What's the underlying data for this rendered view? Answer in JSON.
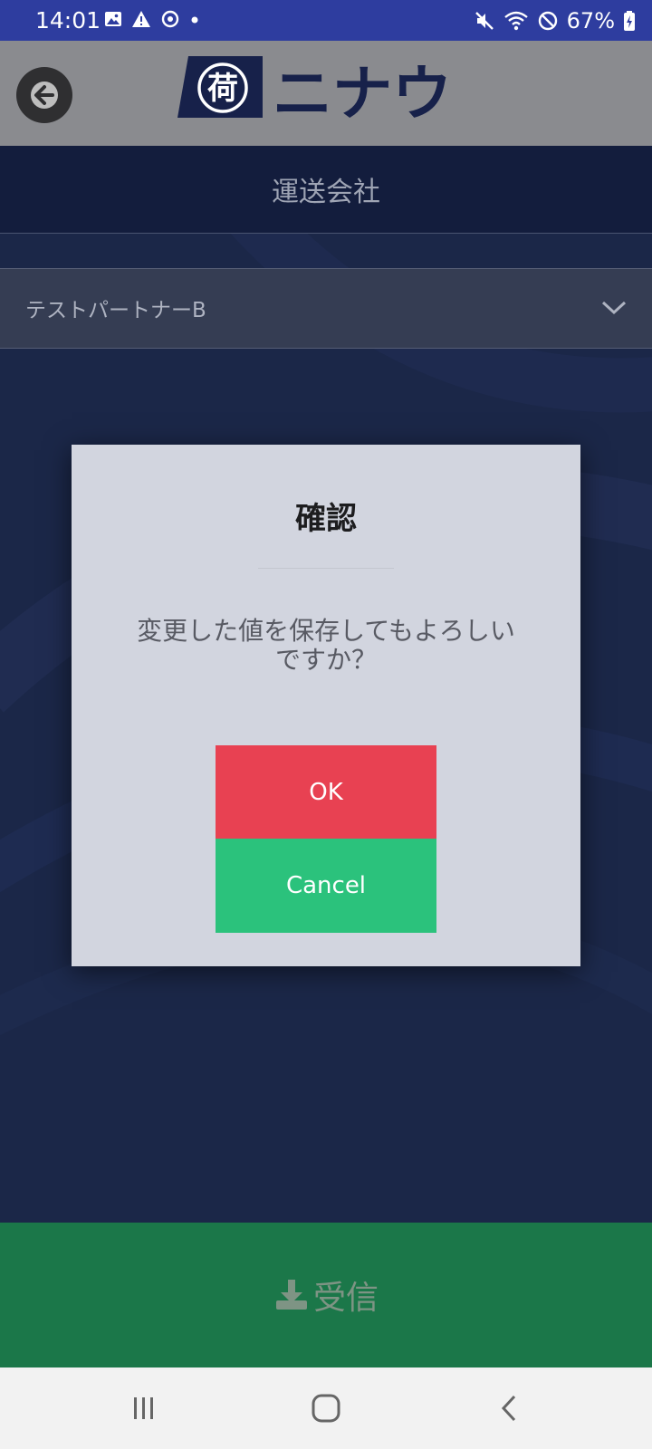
{
  "status_bar": {
    "time": "14:01",
    "battery": "67%",
    "left_icons": [
      "image-icon",
      "warning-icon",
      "sync-icon",
      "notification-dot-icon"
    ],
    "right_icons": [
      "mute-icon",
      "wifi-icon",
      "do-not-disturb-icon",
      "battery-charging-icon"
    ]
  },
  "header": {
    "back_icon": "arrow-left-icon",
    "logo_mark": "荷",
    "logo_text": "ニナウ"
  },
  "page": {
    "title": "運送会社",
    "company_select": {
      "value": "テストパートナーB",
      "icon": "chevron-down-icon"
    }
  },
  "modal": {
    "title": "確認",
    "message": "変更した値を保存してもよろしいですか？",
    "ok_label": "OK",
    "cancel_label": "Cancel"
  },
  "receive_bar": {
    "icon": "download-icon",
    "label": "受信"
  },
  "nav_bar": {
    "items": [
      "recent-apps-icon",
      "home-icon",
      "back-icon"
    ]
  },
  "colors": {
    "status_bar": "#2e3d9f",
    "header": "#8a8b8f",
    "page_background": "#1b2748",
    "ok_button": "#e84152",
    "cancel_button": "#2bc27c",
    "receive_bar": "#1b7749",
    "modal_background": "#d2d5df"
  }
}
